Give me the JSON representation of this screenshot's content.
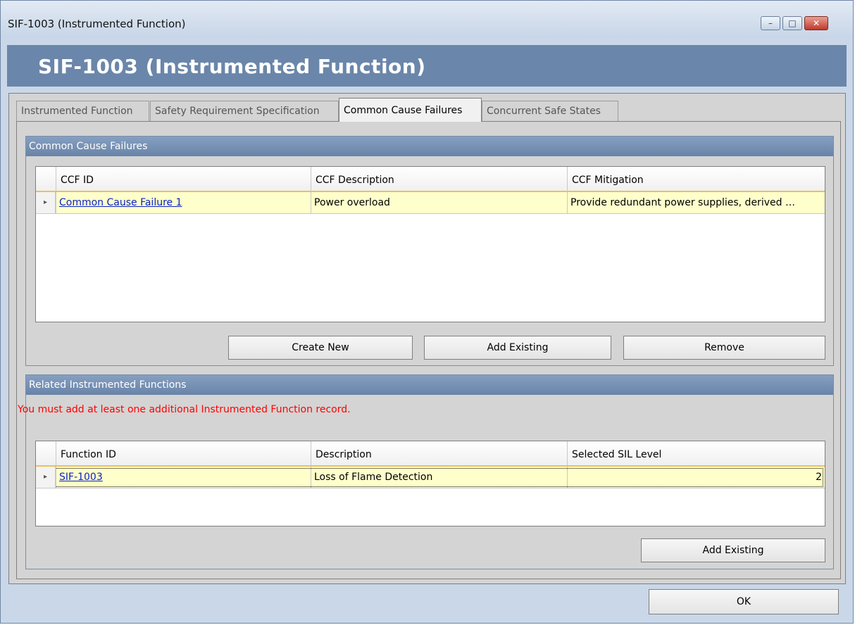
{
  "window": {
    "title": "SIF-1003 (Instrumented Function)",
    "header_title": "SIF-1003 (Instrumented Function)",
    "controls": {
      "minimize": "–",
      "maximize": "□",
      "close": "✕"
    }
  },
  "tabs": [
    {
      "label": "Instrumented Function",
      "active": false
    },
    {
      "label": "Safety Requirement Specification",
      "active": false
    },
    {
      "label": "Common Cause Failures",
      "active": true
    },
    {
      "label": "Concurrent Safe States",
      "active": false
    }
  ],
  "ccf_group": {
    "title": "Common Cause Failures",
    "columns": [
      "CCF ID",
      "CCF Description",
      "CCF Mitigation"
    ],
    "rows": [
      {
        "id": "Common Cause Failure 1",
        "description": "Power overload",
        "mitigation": "Provide redundant power supplies, derived …"
      }
    ],
    "buttons": {
      "create_new": "Create New",
      "add_existing": "Add Existing",
      "remove": "Remove"
    }
  },
  "related_group": {
    "title": "Related Instrumented Functions",
    "warning": "You must add at least one additional Instrumented Function record.",
    "columns": [
      "Function ID",
      "Description",
      "Selected SIL Level"
    ],
    "rows": [
      {
        "function_id": "SIF-1003",
        "description": "Loss of Flame Detection",
        "sil_level": "2"
      }
    ],
    "buttons": {
      "add_existing": "Add Existing"
    }
  },
  "footer": {
    "ok": "OK"
  },
  "icons": {
    "row_indicator": "▸"
  },
  "colors": {
    "header_band": "#6a86aa",
    "warning": "#ff0000",
    "link": "#0a22c8",
    "row_highlight": "#ffffcc"
  }
}
